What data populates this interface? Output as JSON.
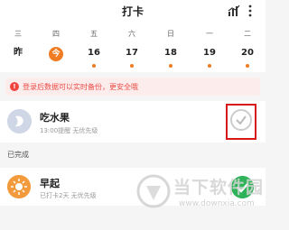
{
  "header": {
    "title": "打卡",
    "stats_icon": "bar-chart-icon",
    "more_icon": "more-vertical-icon"
  },
  "week": {
    "days": [
      {
        "weekday": "三",
        "date": "昨",
        "dot": false,
        "today": false
      },
      {
        "weekday": "四",
        "date": "今",
        "dot": false,
        "today": true
      },
      {
        "weekday": "五",
        "date": "16",
        "dot": true,
        "today": false
      },
      {
        "weekday": "六",
        "date": "17",
        "dot": true,
        "today": false
      },
      {
        "weekday": "日",
        "date": "18",
        "dot": true,
        "today": false
      },
      {
        "weekday": "一",
        "date": "19",
        "dot": true,
        "today": false
      },
      {
        "weekday": "二",
        "date": "20",
        "dot": true,
        "today": false
      }
    ],
    "accent_color": "#f07b22"
  },
  "banner": {
    "icon": "exclamation-icon",
    "text": "登录后数据可以实时备份，更安全哦"
  },
  "tasks": [
    {
      "name": "吃水果",
      "meta": "13:00提醒  无优先级",
      "icon": "fruit-icon",
      "checked": false
    }
  ],
  "completed": {
    "label": "已完成",
    "items": [
      {
        "name": "早起",
        "meta": "已打卡2天  无优先级",
        "icon": "sunrise-icon",
        "checked": true,
        "check_color": "#2fb35a"
      }
    ]
  },
  "watermark": {
    "text": "当下软件园",
    "url": "www.downxia.com"
  }
}
